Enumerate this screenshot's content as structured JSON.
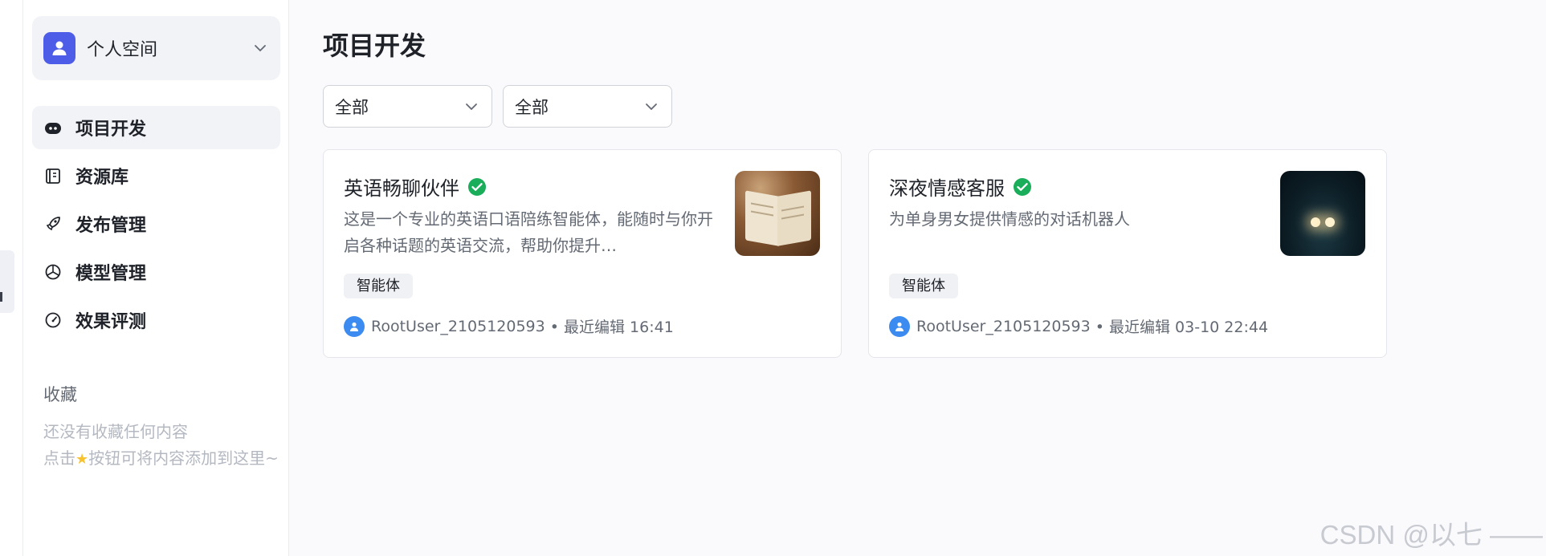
{
  "sidebar": {
    "space": {
      "label": "个人空间",
      "icon": "user-icon"
    },
    "nav": [
      {
        "label": "项目开发",
        "icon": "bot-icon",
        "active": true
      },
      {
        "label": "资源库",
        "icon": "library-icon",
        "active": false
      },
      {
        "label": "发布管理",
        "icon": "rocket-icon",
        "active": false
      },
      {
        "label": "模型管理",
        "icon": "cube-icon",
        "active": false
      },
      {
        "label": "效果评测",
        "icon": "gauge-icon",
        "active": false
      }
    ],
    "favorites": {
      "title": "收藏",
      "empty_line1": "还没有收藏任何内容",
      "empty_line2_before": "点击",
      "empty_line2_after": "按钮可将内容添加到这里~"
    }
  },
  "main": {
    "title": "项目开发",
    "filters": [
      {
        "value": "全部"
      },
      {
        "value": "全部"
      }
    ],
    "cards": [
      {
        "title": "英语畅聊伙伴",
        "description": "这是一个专业的英语口语陪练智能体，能随时与你开启各种话题的英语交流，帮助你提升…",
        "tag": "智能体",
        "author": "RootUser_2105120593",
        "edited": "• 最近编辑 16:41",
        "thumb": "open-book-image"
      },
      {
        "title": "深夜情感客服",
        "description": "为单身男女提供情感的对话机器人",
        "tag": "智能体",
        "author": "RootUser_2105120593",
        "edited": "• 最近编辑 03-10 22:44",
        "thumb": "night-lights-image"
      }
    ]
  },
  "watermark": "CSDN @以七 ——",
  "colors": {
    "accent": "#4e5de8",
    "verified": "#1aad5a",
    "avatar": "#3c8bf0"
  }
}
